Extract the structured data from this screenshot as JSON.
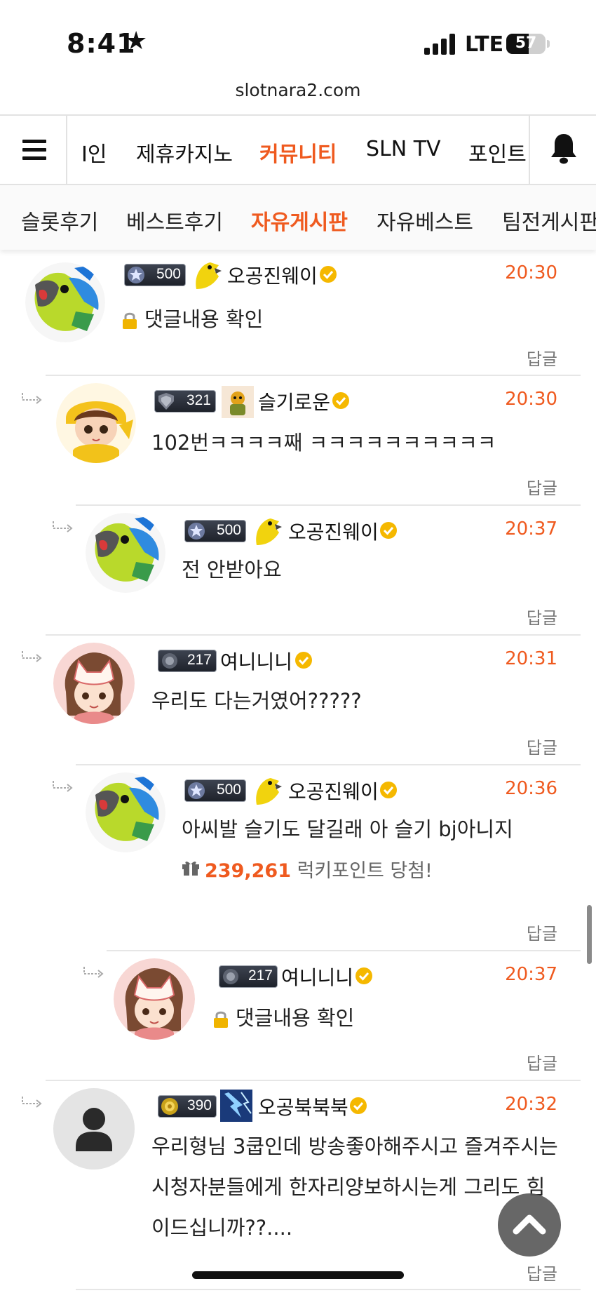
{
  "status_bar": {
    "time": "8:41",
    "network": "LTE",
    "battery": "57",
    "battery_level": 0.57
  },
  "browser": {
    "url": "slotnara2.com"
  },
  "top_nav": {
    "items": [
      {
        "label": "I인",
        "active": false
      },
      {
        "label": "제휴카지노",
        "active": false
      },
      {
        "label": "커뮤니티",
        "active": true
      },
      {
        "label": "SLN TV",
        "active": false
      },
      {
        "label": "포인트",
        "active": false
      }
    ]
  },
  "sub_nav": {
    "items": [
      {
        "label": "슬롯후기",
        "active": false
      },
      {
        "label": "베스트후기",
        "active": false
      },
      {
        "label": "자유게시판",
        "active": true
      },
      {
        "label": "자유베스트",
        "active": false
      },
      {
        "label": "팀전게시판",
        "active": false
      }
    ]
  },
  "reply_label": "답글",
  "comments": [
    {
      "level": "500",
      "nickname": "오공진웨이",
      "time": "20:30",
      "text": "댓글내용 확인",
      "locked": true
    },
    {
      "level": "321",
      "nickname": "슬기로운",
      "time": "20:30",
      "text": "102번ㅋㅋㅋㅋ째 ㅋㅋㅋㅋㅋㅋㅋㅋㅋㅋ",
      "locked": false
    },
    {
      "level": "500",
      "nickname": "오공진웨이",
      "time": "20:37",
      "text": "전 안받아요",
      "locked": false
    },
    {
      "level": "217",
      "nickname": "여니니니",
      "time": "20:31",
      "text": "우리도 다는거였어?????",
      "locked": false
    },
    {
      "level": "500",
      "nickname": "오공진웨이",
      "time": "20:36",
      "text": "아씨발 슬기도 달길래 아 슬기 bj아니지",
      "locked": false,
      "lucky": {
        "points": "239,261",
        "label": "럭키포인트 당첨!"
      }
    },
    {
      "level": "217",
      "nickname": "여니니니",
      "time": "20:37",
      "text": "댓글내용 확인",
      "locked": true
    },
    {
      "level": "390",
      "nickname": "오공북북북",
      "time": "20:32",
      "lines": [
        "우리형님 3쿱인데 방송좋아해주시고 즐겨주시는",
        "시청자분들에게 한자리양보하시는게 그리도 힘",
        "이드십니까??...."
      ],
      "locked": false
    }
  ],
  "colors": {
    "accent": "#ef5a1f",
    "verified": "#f5b800",
    "divider": "#e6e6e6"
  },
  "icons": {
    "menu": "hamburger-icon",
    "bell": "bell-icon",
    "lock": "lock-icon",
    "gift": "gift-icon",
    "verified": "verified-check-icon",
    "scroll_top": "chevron-up-icon"
  }
}
